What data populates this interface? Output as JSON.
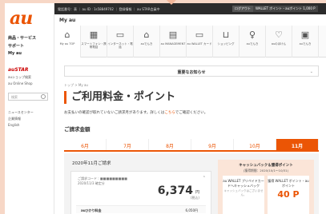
{
  "sidebar": {
    "logo": "au",
    "nav": [
      "商品・サービス",
      "サポート",
      "My au"
    ],
    "austar": "auSTAR",
    "sub_links": [
      "auショップ検索",
      "au Online Shop"
    ],
    "search_placeholder": "検索",
    "bottom_links": [
      "ニュースセンター",
      "企業情報",
      "English"
    ]
  },
  "topbar": {
    "crumbs": "電話番号：表 ｜ au ID : 1s58849702 ｜ 登録情報 ｜ au STAR会員中",
    "btn1": "ログアウト",
    "btn2": "WALLET ポイント・auポイント 1,000 P",
    "btn3": "ログアウト"
  },
  "header": {
    "title": "My au"
  },
  "icons": [
    {
      "glyph": "⌂",
      "label": "My au TOP"
    },
    {
      "glyph": "▦",
      "label": "スマートフォン・携帯電話"
    },
    {
      "glyph": "▭",
      "label": "インターネット・電話"
    },
    {
      "glyph": "⌂",
      "label": "auでんき"
    },
    {
      "glyph": "▤",
      "label": "au MANAGEMENT"
    },
    {
      "glyph": "▭",
      "label": "au WALLET カード"
    },
    {
      "glyph": "⊔",
      "label": "ショッピング"
    },
    {
      "glyph": "♀",
      "label": "auでんき"
    },
    {
      "glyph": "♡",
      "label": "auのほけん"
    },
    {
      "glyph": "▣",
      "label": "auでんき"
    }
  ],
  "notice": {
    "label": "重要なお知らせ"
  },
  "breadcrumb": "トップ > My au",
  "page": {
    "title": "ご利用料金・ポイント",
    "lead_pre": "お支払いの確認が取れていないご請求月があります。詳しくは",
    "lead_link": "こちら",
    "lead_post": "でご確認ください。",
    "section": "ご請求金額"
  },
  "months": [
    "6月",
    "7月",
    "8月",
    "9月",
    "10月",
    "11月"
  ],
  "selected_month_index": 5,
  "billing": {
    "panel_title": "2020年11月ご請求",
    "code_label": "ご請求コード : ■■■■■■■■■",
    "date_label": "2020/11/3 確定分",
    "amount": "6,374",
    "yen": "円",
    "tax_note": "(税込)",
    "row_label": "auひかり料金",
    "row_value": "6,050円"
  },
  "cashback": {
    "heading": "キャッシュバック＆獲得ポイント",
    "period": "(獲得期間：2020/10/1〜10/31)",
    "box1_title": "au WALLET プリペイドカードへキャッシュバック",
    "box1_sub": "キャッシュバックはございません。",
    "box2_title": "獲得 WALLET ポイント・auポイント",
    "box2_points": "40 P"
  },
  "colors": {
    "accent": "#eb5505",
    "background": "#f7d7c6"
  }
}
